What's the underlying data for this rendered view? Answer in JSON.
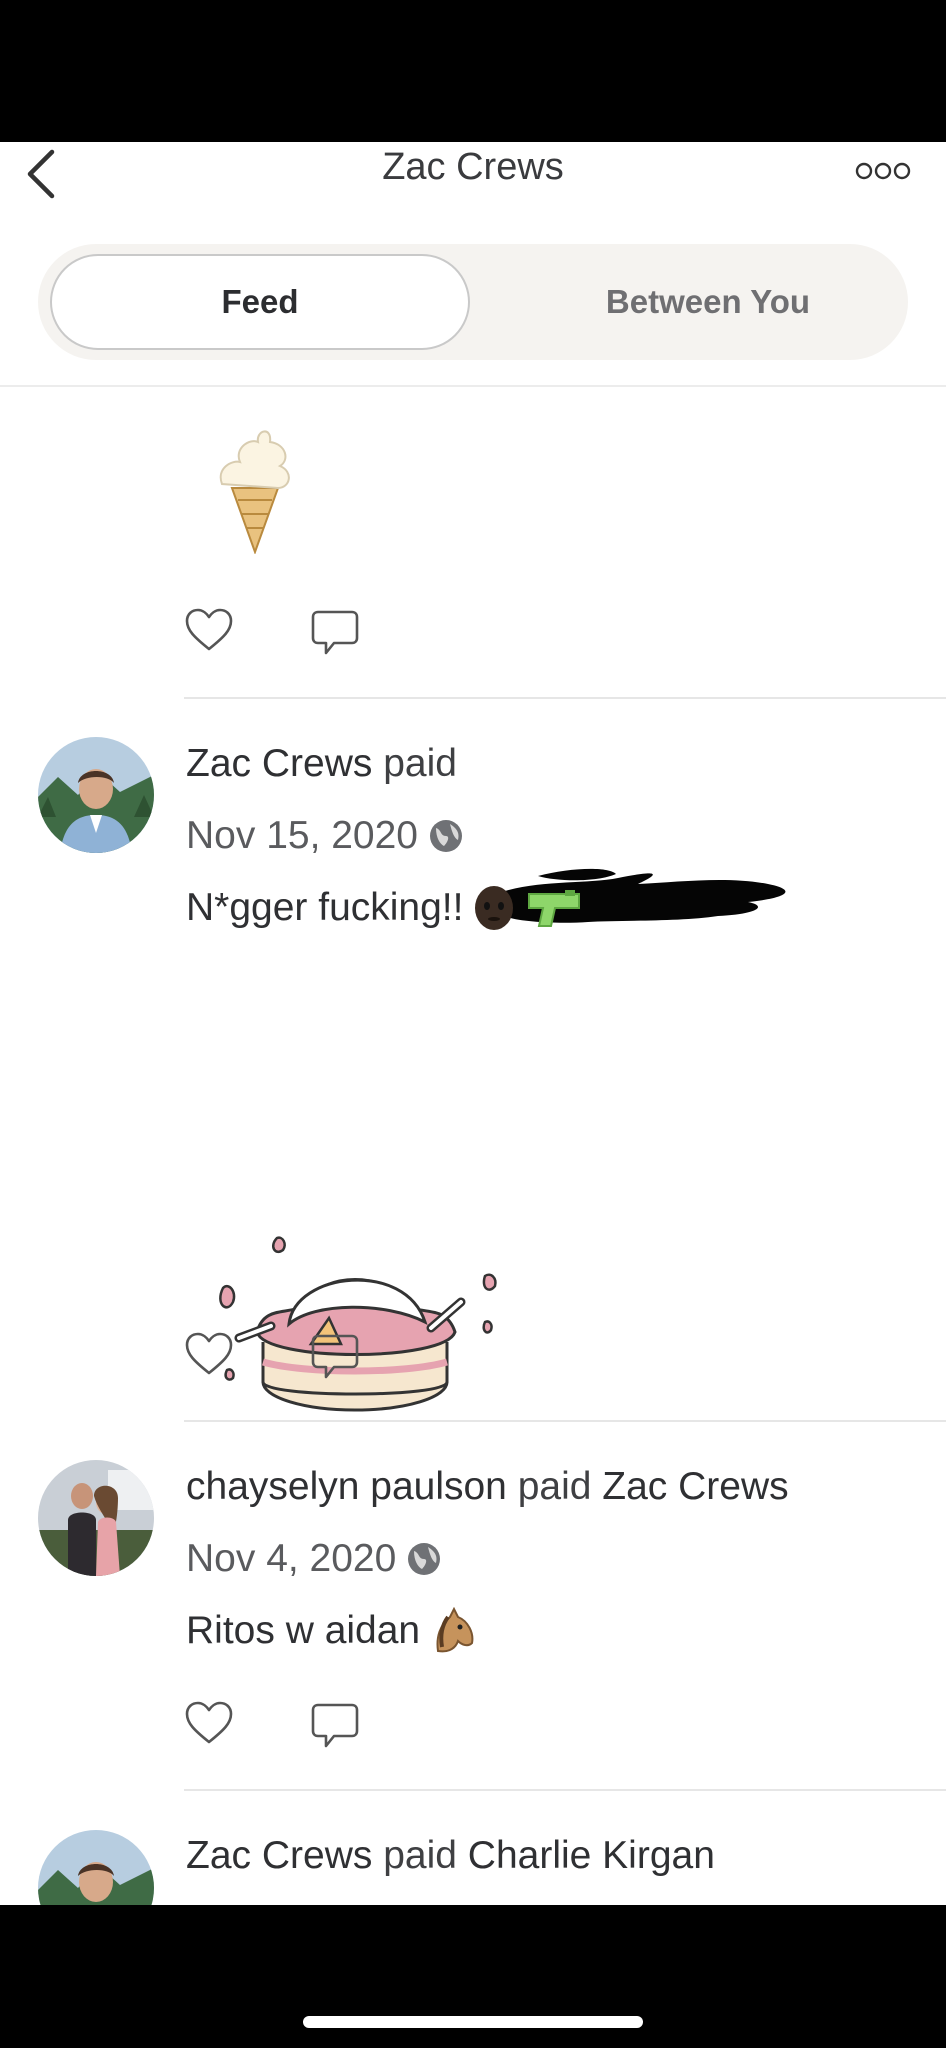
{
  "nav": {
    "title": "Zac Crews",
    "back_icon": "chevron-left-icon",
    "more_icon": "more-horizontal-icon"
  },
  "tabs": {
    "feed": "Feed",
    "between": "Between You",
    "selected": "Feed"
  },
  "feed": [
    {
      "attachment": "ice-cream-cone-sticker"
    },
    {
      "payer": "Zac Crews",
      "verb": "paid",
      "payee": "",
      "payee_redacted": true,
      "date": "Nov 15, 2020",
      "visibility_icon": "globe-icon",
      "note": "N*gger fucking!!",
      "note_emojis": [
        "dark-skin-head-emoji",
        "water-pistol-emoji"
      ],
      "attachment": "smashed-cake-sticker"
    },
    {
      "payer": "chayselyn paulson",
      "verb": "paid",
      "payee": "Zac Crews",
      "date": "Nov 4, 2020",
      "visibility_icon": "globe-icon",
      "note": "Ritos w aidan",
      "note_emojis": [
        "horse-face-emoji"
      ]
    },
    {
      "payer": "Zac Crews",
      "verb": "paid",
      "payee": "Charlie Kirgan"
    }
  ],
  "colors": {
    "text": "#2f3033",
    "muted": "#6f6f72",
    "segment_bg": "#f5f3f0",
    "divider": "#e6e6e6"
  }
}
